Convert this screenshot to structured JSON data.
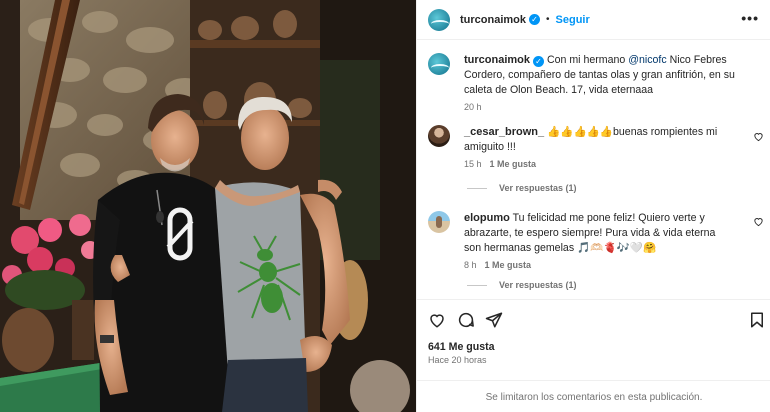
{
  "post": {
    "username": "turconaimok",
    "follow_label": "Seguir",
    "separator": "•",
    "more_label": "•••",
    "verified_mark": "✓",
    "photo_icon": "photo-two-men-by-stone-wall"
  },
  "caption": {
    "username": "turconaimok",
    "text_before": "Con mi hermano ",
    "mention": "@nicofc",
    "text_after": " Nico Febres Cordero, compañero de tantas olas y gran anfitrión, en su caleta de Olon Beach. 17, vida eternaaa",
    "time": "20 h"
  },
  "comments": [
    {
      "username": "_cesar_brown_",
      "text": "👍👍👍👍👍buenas rompientes mi amiguito !!!",
      "time": "15 h",
      "likes": "1 Me gusta",
      "replies": "Ver respuestas (1)"
    },
    {
      "username": "elopumo",
      "text": "Tu felicidad me pone feliz! Quiero verte y abrazarte, te espero siempre! Pura vida & vida eterna son hermanas gemelas 🎵🫶🏻🫀🎶🤍🤗",
      "time": "8 h",
      "likes": "1 Me gusta",
      "replies": "Ver respuestas (1)"
    }
  ],
  "footer": {
    "likes": "641 Me gusta",
    "ago": "Hace 20 horas",
    "limited": "Se limitaron los comentarios en esta publicación."
  },
  "icons": [
    "verified-icon",
    "more-icon",
    "heart-icon",
    "comment-icon",
    "share-icon",
    "bookmark-icon"
  ],
  "colors": {
    "accent": "#0095f6",
    "text": "#262626",
    "muted": "#737373",
    "mention": "#00376b"
  }
}
